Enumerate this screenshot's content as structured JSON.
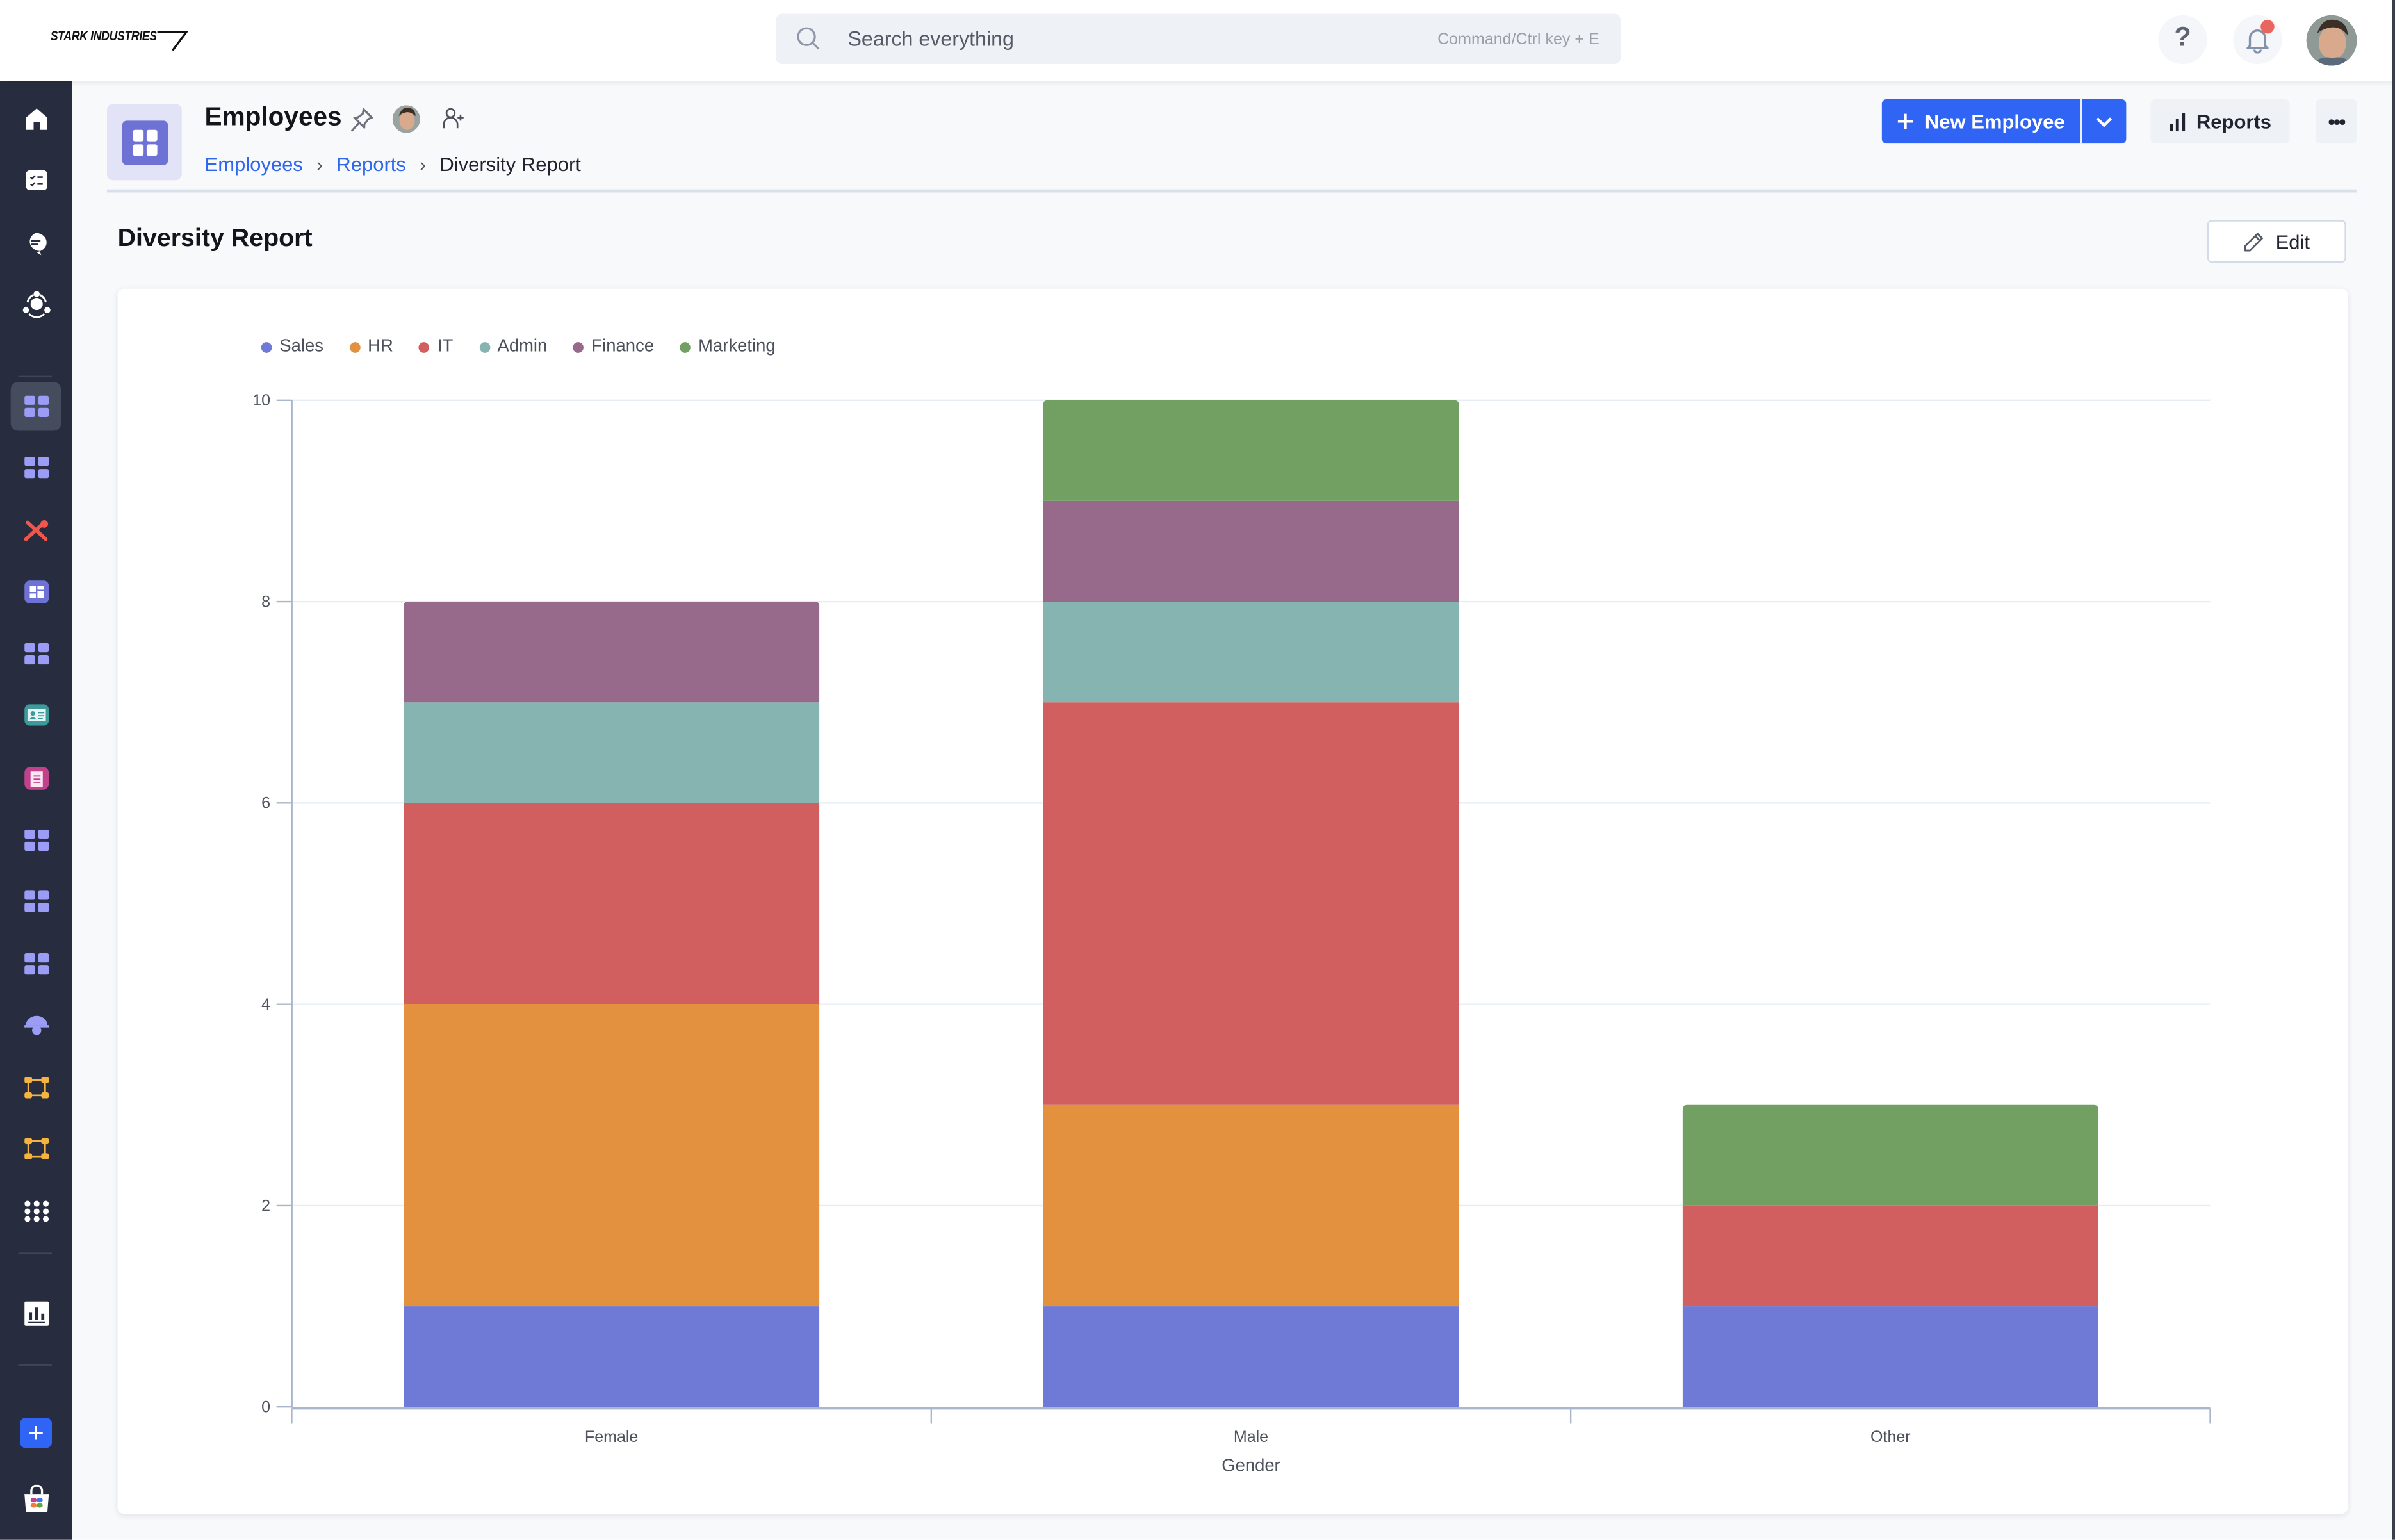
{
  "topbar": {
    "logo_text": "STARK INDUSTRIES",
    "search_placeholder": "Search everything",
    "search_hint": "Command/Ctrl key + E",
    "help_label": "?",
    "notification_badge": true
  },
  "sidebar": {
    "items": [
      {
        "icon": "home-icon",
        "color": "#ffffff"
      },
      {
        "icon": "tasks-icon",
        "color": "#ffffff"
      },
      {
        "icon": "chat-icon",
        "color": "#ffffff"
      },
      {
        "icon": "network-icon",
        "color": "#ffffff"
      },
      {
        "icon": "grid-app-icon",
        "color": "#9b9cf6",
        "active": true
      },
      {
        "icon": "grid-app-icon",
        "color": "#9b9cf6"
      },
      {
        "icon": "tools-icon",
        "color": "#f0564b"
      },
      {
        "icon": "dashboard-app-icon",
        "color": "#6e72d4"
      },
      {
        "icon": "grid-app-icon",
        "color": "#9b9cf6"
      },
      {
        "icon": "id-card-icon",
        "color": "#3e9a9a"
      },
      {
        "icon": "clipboard-icon",
        "color": "#c2418d"
      },
      {
        "icon": "grid-app-icon",
        "color": "#9b9cf6"
      },
      {
        "icon": "grid-app-icon",
        "color": "#9b9cf6"
      },
      {
        "icon": "grid-app-icon",
        "color": "#9b9cf6"
      },
      {
        "icon": "hardhat-gear-icon",
        "color": "#9b9cf6"
      },
      {
        "icon": "workflow-icon",
        "color": "#f5b342"
      },
      {
        "icon": "workflow-icon",
        "color": "#f5b342"
      },
      {
        "icon": "apps-dots-icon",
        "color": "#ffffff"
      },
      {
        "icon": "reports-chart-icon",
        "color": "#ffffff"
      },
      {
        "icon": "add-icon",
        "color": "#2f64f5"
      },
      {
        "icon": "marketplace-bag-icon",
        "color": "#ffffff"
      }
    ]
  },
  "header": {
    "title": "Employees",
    "breadcrumbs": [
      {
        "label": "Employees",
        "link": true
      },
      {
        "label": "Reports",
        "link": true
      },
      {
        "label": "Diversity Report",
        "link": false
      }
    ],
    "new_button": "New Employee",
    "reports_button": "Reports",
    "more_button": "•••"
  },
  "report": {
    "title": "Diversity Report",
    "edit_button": "Edit"
  },
  "chart_data": {
    "type": "bar",
    "stacked": true,
    "title": "",
    "xlabel": "Gender",
    "ylabel": "",
    "categories": [
      "Female",
      "Male",
      "Other"
    ],
    "series": [
      {
        "name": "Sales",
        "color": "#6e7ad6",
        "values": [
          1,
          1,
          1
        ]
      },
      {
        "name": "HR",
        "color": "#e3913f",
        "values": [
          3,
          2,
          0
        ]
      },
      {
        "name": "IT",
        "color": "#d15f5f",
        "values": [
          2,
          4,
          1
        ]
      },
      {
        "name": "Admin",
        "color": "#86b4b0",
        "values": [
          1,
          1,
          0
        ]
      },
      {
        "name": "Finance",
        "color": "#97698b",
        "values": [
          1,
          1,
          0
        ]
      },
      {
        "name": "Marketing",
        "color": "#72a063",
        "values": [
          0,
          1,
          1
        ]
      }
    ],
    "ylim": [
      0,
      10
    ],
    "yticks": [
      0,
      2,
      4,
      6,
      8,
      10
    ],
    "grid": true,
    "legend_position": "top-left"
  }
}
